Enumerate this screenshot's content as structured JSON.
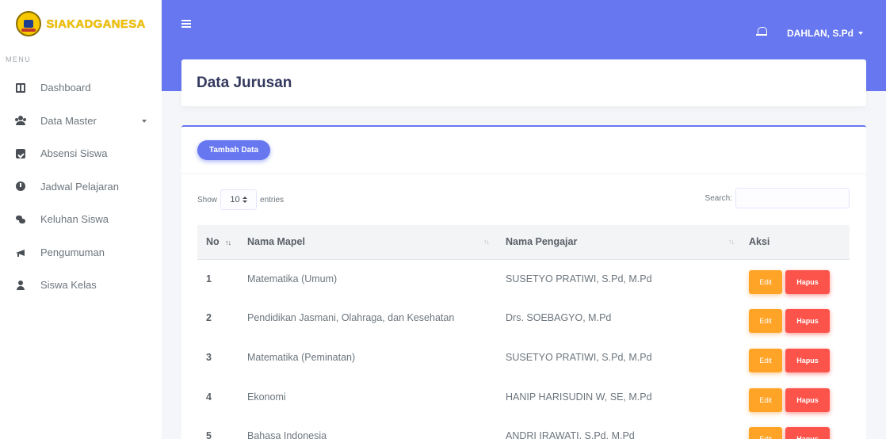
{
  "brand": {
    "name": "SIAKADGANESA"
  },
  "sidebar": {
    "menu_header": "MENU",
    "items": [
      {
        "label": "Dashboard",
        "icon": "dashboard-icon"
      },
      {
        "label": "Data Master",
        "icon": "users-icon",
        "has_submenu": true
      },
      {
        "label": "Absensi Siswa",
        "icon": "calendar-check-icon"
      },
      {
        "label": "Jadwal Pelajaran",
        "icon": "clock-icon"
      },
      {
        "label": "Keluhan Siswa",
        "icon": "comments-icon"
      },
      {
        "label": "Pengumuman",
        "icon": "megaphone-icon"
      },
      {
        "label": "Siswa Kelas",
        "icon": "user-icon"
      }
    ]
  },
  "topbar": {
    "user_name": "DAHLAN, S.Pd",
    "accent_color": "#6777ef"
  },
  "section": {
    "title": "Data Jurusan"
  },
  "card": {
    "add_button": "Tambah Data",
    "length": {
      "show_label": "Show",
      "value": "10",
      "entries_label": "entries"
    },
    "search_label": "Search:",
    "search_value": ""
  },
  "table": {
    "columns": [
      "No",
      "Nama Mapel",
      "Nama Pengajar",
      "Aksi"
    ],
    "rows": [
      {
        "no": "1",
        "mapel": "Matematika (Umum)",
        "pengajar": "SUSETYO PRATIWI, S.Pd, M.Pd"
      },
      {
        "no": "2",
        "mapel": "Pendidikan Jasmani, Olahraga, dan Kesehatan",
        "pengajar": "Drs. SOEBAGYO, M.Pd"
      },
      {
        "no": "3",
        "mapel": "Matematika (Peminatan)",
        "pengajar": "SUSETYO PRATIWI, S.Pd, M.Pd"
      },
      {
        "no": "4",
        "mapel": "Ekonomi",
        "pengajar": "HANIP HARISUDIN W, SE, M.Pd"
      },
      {
        "no": "5",
        "mapel": "Bahasa Indonesia",
        "pengajar": "ANDRI IRAWATI, S.Pd, M.Pd"
      }
    ],
    "edit_label": "Edit",
    "delete_label": "Hapus",
    "sort_icon": "↑↓",
    "edit_color": "#ffa426",
    "delete_color": "#fc544b"
  }
}
